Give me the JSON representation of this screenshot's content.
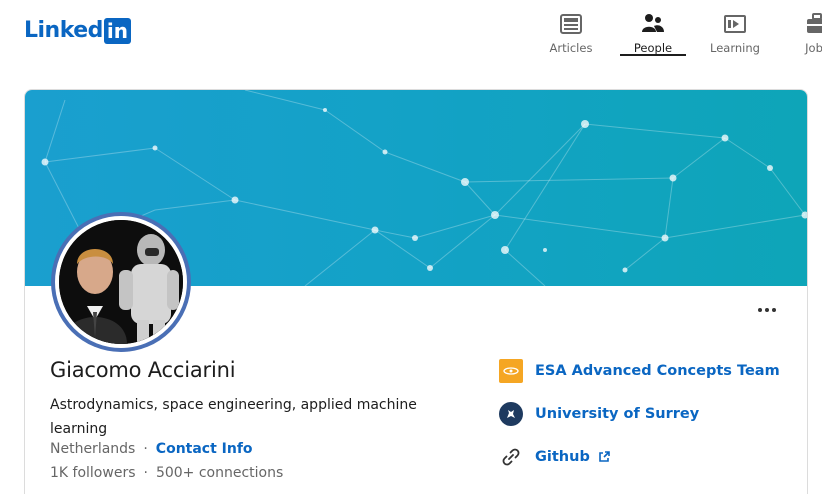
{
  "header": {
    "logo_word": "Linked",
    "logo_box": "in",
    "nav": [
      {
        "label": "Articles",
        "icon": "articles-icon",
        "active": false
      },
      {
        "label": "People",
        "icon": "people-icon",
        "active": true
      },
      {
        "label": "Learning",
        "icon": "learning-icon",
        "active": false
      },
      {
        "label": "Jobs",
        "icon": "jobs-icon",
        "active": false
      }
    ]
  },
  "profile": {
    "name": "Giacomo Acciarini",
    "headline": "Astrodynamics, space engineering, applied machine learning",
    "location": "Netherlands",
    "contact_label": "Contact Info",
    "followers": "1K followers",
    "connections": "500+ connections",
    "more_label": "More actions"
  },
  "side_links": {
    "company": "ESA Advanced Concepts Team",
    "school": "University of Surrey",
    "website": "Github"
  },
  "colors": {
    "brand": "#0a66c2",
    "banner_start": "#1a9fcf",
    "banner_end": "#0ea5b8"
  }
}
